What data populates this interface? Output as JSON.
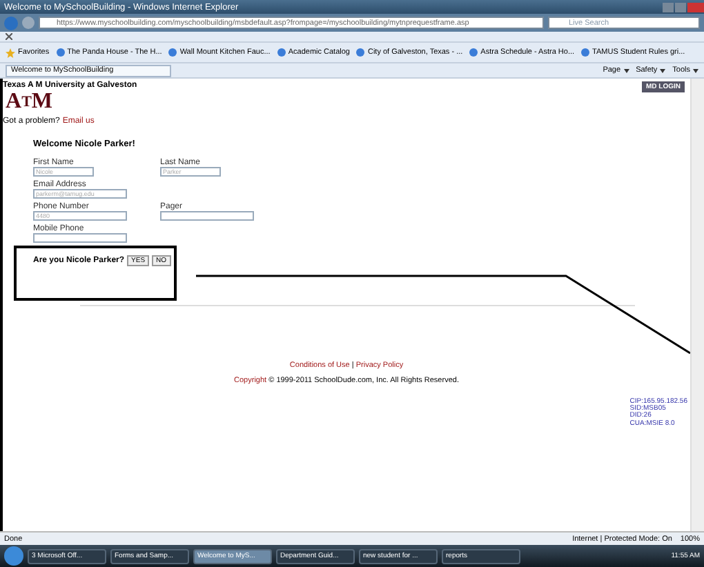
{
  "window": {
    "title": "Welcome to MySchoolBuilding - Windows Internet Explorer"
  },
  "address": {
    "url": "https://www.myschoolbuilding.com/myschoolbuilding/msbdefault.asp?frompage=/myschoolbuilding/mytnprequestframe.asp",
    "search_placeholder": "Live Search"
  },
  "favorites": {
    "label": "Favorites",
    "items": [
      "The Panda House - The H...",
      "Wall Mount Kitchen Fauc...",
      "Academic Catalog",
      "City of Galveston, Texas - ...",
      "Astra Schedule - Astra Ho...",
      "TAMUS Student Rules gri..."
    ]
  },
  "tab": {
    "label": "Welcome to MySchoolBuilding"
  },
  "commands": [
    "Page",
    "Safety",
    "Tools"
  ],
  "page": {
    "university": "Texas A M University at Galveston",
    "logo": [
      "A",
      "T",
      "M"
    ],
    "login": "MD LOGIN",
    "problem": "Got a problem?",
    "email_link": "Email us",
    "welcome": "Welcome Nicole Parker!",
    "field_rows": [
      [
        {
          "label": "First Name",
          "value": "Nicole"
        },
        {
          "label": "Last Name",
          "value": "Parker"
        }
      ],
      [
        {
          "label": "Email Address",
          "value": "parkerm@tamug.edu"
        }
      ],
      [
        {
          "label": "Phone Number",
          "value": "4480"
        },
        {
          "label": "Pager"
        }
      ],
      [
        {
          "label": "Mobile Phone"
        }
      ]
    ],
    "question": "Are you Nicole Parker?",
    "buttons": [
      "YES",
      "NO"
    ],
    "footer_links": [
      "Conditions of Use",
      "Privacy Policy"
    ],
    "footer_separator": "|",
    "copyright_link": "Copyright",
    "copyright": "© 1999-2011 SchoolDude.com, Inc. All Rights Reserved.",
    "info": [
      "CIP:165.95.182.56",
      "SID:MSB05",
      "DID:26",
      "CUA:MSIE 8.0"
    ]
  },
  "status_bar": {
    "text": "Done",
    "zone": "Internet | Protected Mode: On",
    "zoom": "100%"
  },
  "taskbar": {
    "items": [
      {
        "label": "3 Microsoft Off...",
        "selected": false
      },
      {
        "label": "Forms and Samp...",
        "selected": false
      },
      {
        "label": "Welcome to MyS...",
        "selected": true
      },
      {
        "label": "Department Guid...",
        "selected": false
      },
      {
        "label": "new student for ...",
        "selected": false
      },
      {
        "label": "reports",
        "selected": false
      }
    ],
    "clock": "11:55 AM"
  }
}
